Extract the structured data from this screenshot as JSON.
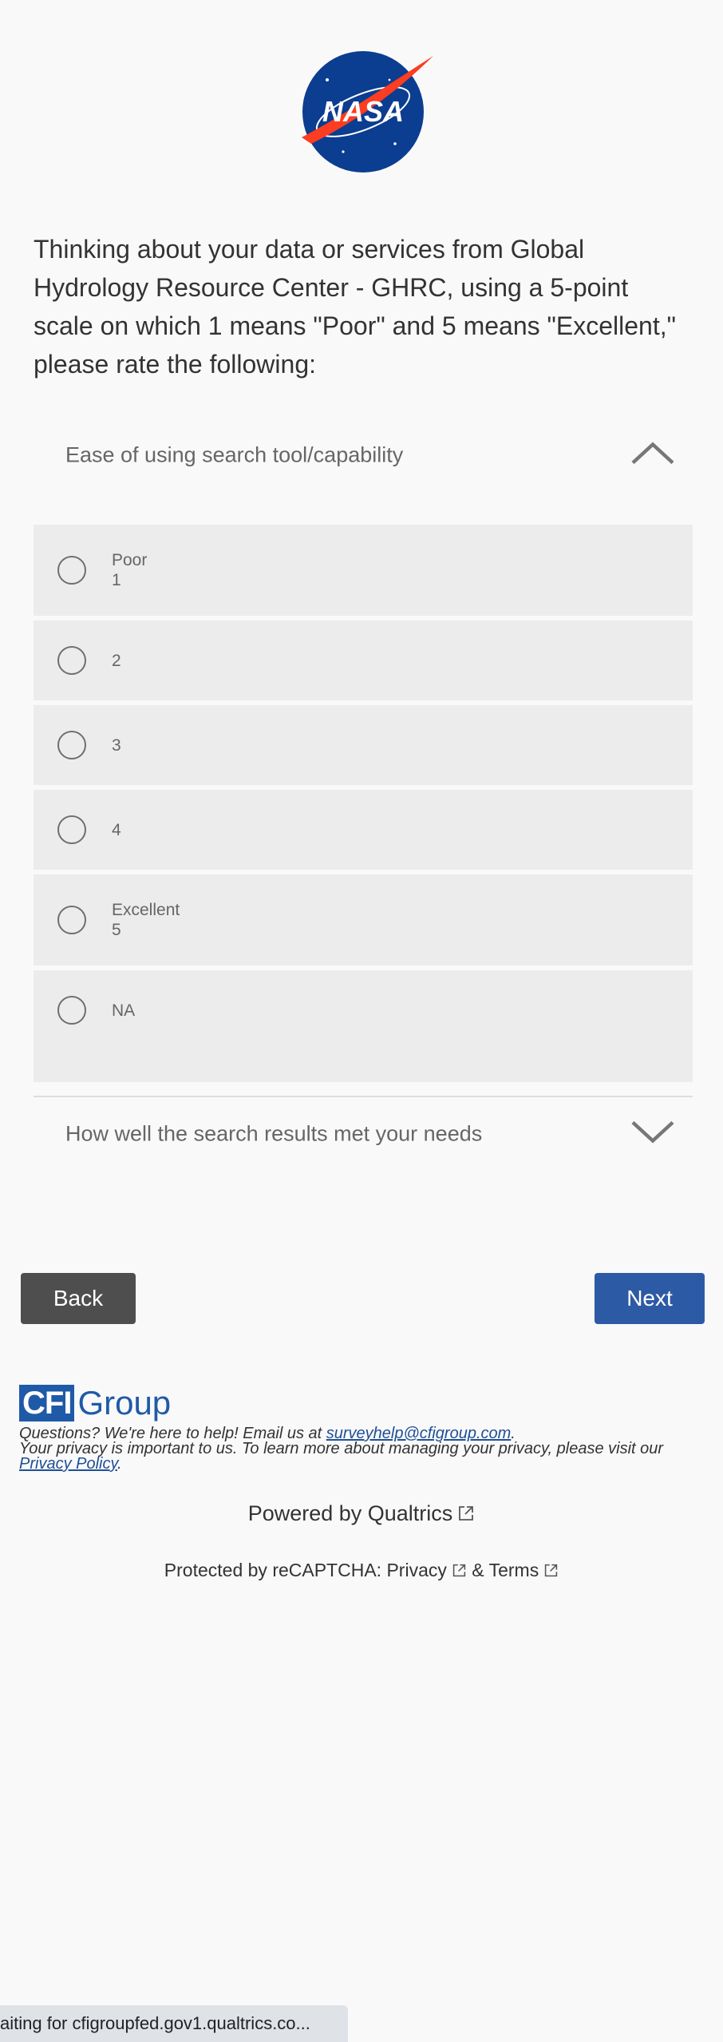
{
  "logo": {
    "text": "NASA",
    "icon": "nasa-meatball-logo"
  },
  "question": {
    "text": "Thinking about your data or services from Global Hydrology Resource Center - GHRC, using a 5-point scale on which 1 means \"Poor\" and 5 means \"Excellent,\" please rate the following:"
  },
  "accordion": [
    {
      "label": "Ease of using search tool/capability",
      "state": "expanded",
      "icon": "chevron-up-icon"
    },
    {
      "label": "How well the search results met your needs",
      "state": "collapsed",
      "icon": "chevron-down-icon"
    }
  ],
  "choices": [
    {
      "line1": "Poor",
      "line2": "1"
    },
    {
      "line1": "2",
      "line2": ""
    },
    {
      "line1": "3",
      "line2": ""
    },
    {
      "line1": "4",
      "line2": ""
    },
    {
      "line1": "Excellent",
      "line2": "5"
    },
    {
      "line1": "NA",
      "line2": ""
    }
  ],
  "nav": {
    "back_label": "Back",
    "next_label": "Next"
  },
  "footer": {
    "brand_box": "CFI",
    "brand_word": "Group",
    "help_prefix": "Questions? We're here to help! Email us at ",
    "help_email": "surveyhelp@cfigroup.com",
    "help_suffix": ".",
    "privacy_prefix": "Your privacy is important to us. To learn more about managing your privacy, please visit our ",
    "privacy_link": "Privacy Policy",
    "privacy_suffix": ".",
    "powered": "Powered by Qualtrics",
    "recaptcha_prefix": "Protected by reCAPTCHA: ",
    "recaptcha_privacy": "Privacy",
    "recaptcha_amp": " & ",
    "recaptcha_terms": "Terms"
  },
  "status": {
    "text": "aiting for cfigroupfed.gov1.qualtrics.co..."
  },
  "colors": {
    "background": "#f9f9f9",
    "choice_bg": "#ececec",
    "back_button": "#4e4e4e",
    "next_button": "#2d5aa4",
    "cfi_blue": "#1f5aa8"
  }
}
